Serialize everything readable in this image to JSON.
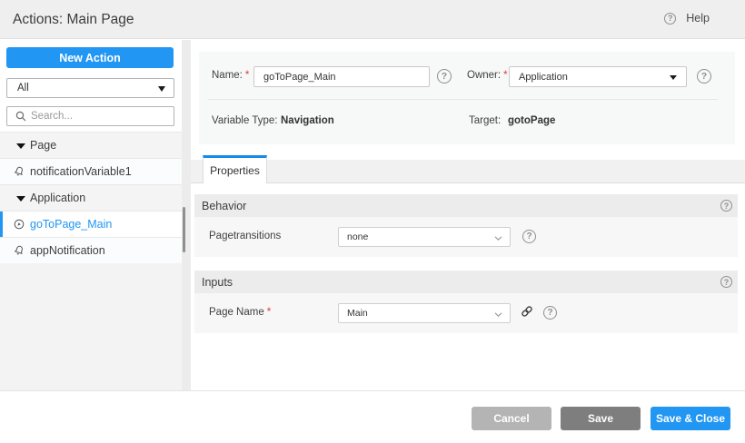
{
  "header": {
    "title": "Actions: Main Page",
    "help_label": "Help"
  },
  "colors": {
    "primary_blue": "#2196f3",
    "tab_accent": "#1789e6",
    "save_gray": "#7e7e7e",
    "cancel_gray": "#b4b4b4",
    "required_red": "#e53935"
  },
  "sidebar": {
    "new_action_label": "New Action",
    "filter_value": "All",
    "search_placeholder": "Search...",
    "tree": [
      {
        "type": "group",
        "label": "Page",
        "expanded": true
      },
      {
        "type": "item",
        "icon": "bell-icon",
        "label": "notificationVariable1",
        "selected": false
      },
      {
        "type": "group",
        "label": "Application",
        "expanded": true
      },
      {
        "type": "item",
        "icon": "navigate-icon",
        "label": "goToPage_Main",
        "selected": true
      },
      {
        "type": "item",
        "icon": "bell-icon",
        "label": "appNotification",
        "selected": false
      }
    ]
  },
  "form": {
    "name_label": "Name:",
    "name_value": "goToPage_Main",
    "owner_label": "Owner:",
    "owner_value": "Application",
    "variable_type_label": "Variable Type:",
    "variable_type_value": "Navigation",
    "target_label": "Target:",
    "target_value": "gotoPage"
  },
  "tabs": [
    {
      "label": "Properties",
      "active": true
    }
  ],
  "sections": [
    {
      "title": "Behavior",
      "row": {
        "label": "Pagetransitions",
        "required": false,
        "value": "none"
      }
    },
    {
      "title": "Inputs",
      "row": {
        "label": "Page Name",
        "required": true,
        "value": "Main"
      }
    }
  ],
  "footer": {
    "cancel_label": "Cancel",
    "save_label": "Save",
    "save_close_label": "Save & Close"
  }
}
